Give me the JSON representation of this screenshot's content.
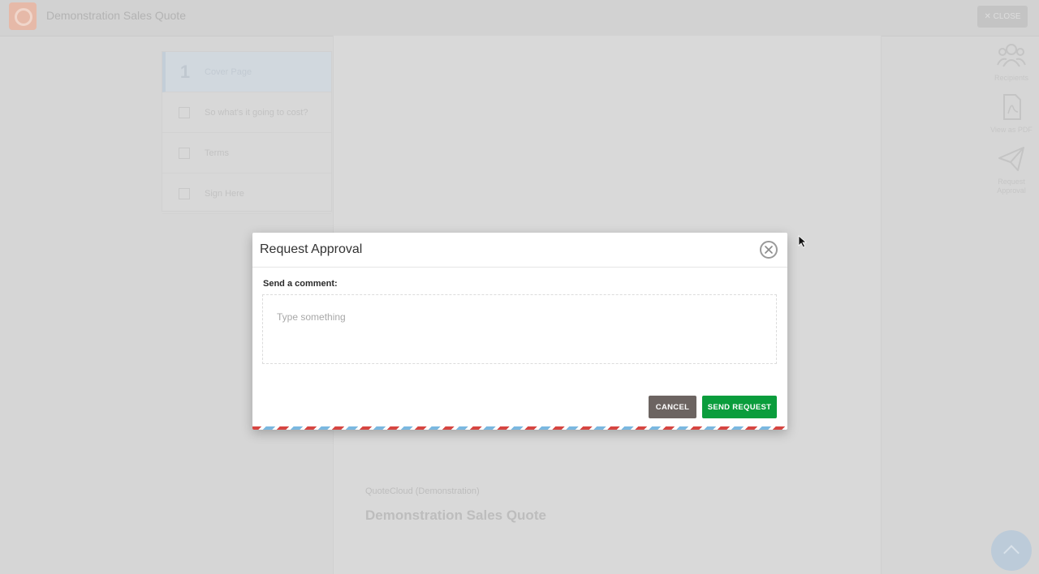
{
  "app": {
    "title": "Demonstration Sales Quote",
    "close_label": "✕ CLOSE"
  },
  "steps": [
    {
      "number": "1",
      "label": "Cover Page",
      "active": true
    },
    {
      "label": "So what's it going to cost?"
    },
    {
      "label": "Terms"
    },
    {
      "label": "Sign Here"
    }
  ],
  "right_rail": [
    {
      "label": "Recipients",
      "icon": "users-icon"
    },
    {
      "label": "View as PDF",
      "icon": "pdf-icon"
    },
    {
      "label": "Request Approval",
      "icon": "paper-plane-icon"
    }
  ],
  "document": {
    "company": "QuoteCloud (Demonstration)",
    "title": "Demonstration Sales Quote"
  },
  "modal": {
    "title": "Request Approval",
    "comment_label": "Send a comment:",
    "comment_placeholder": "Type something",
    "comment_value": "",
    "cancel_label": "CANCEL",
    "send_label": "SEND REQUEST"
  },
  "colors": {
    "send_button": "#0a9d3c",
    "cancel_button": "#6c6461",
    "airmail_red": "#d64541",
    "airmail_blue": "#7ab8e0"
  }
}
